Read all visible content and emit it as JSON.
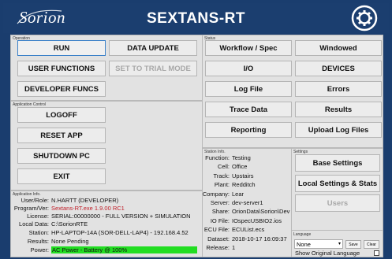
{
  "header": {
    "logo_text": "Sorion",
    "title": "SEXTANS-RT",
    "settings_icon": "gear-refresh-icon"
  },
  "operation": {
    "label": "Operation",
    "buttons": {
      "run": "RUN",
      "data_update": "DATA UPDATE",
      "user_functions": "USER FUNCTIONS",
      "set_to_trial_mode": "SET TO TRIAL MODE",
      "developer_funcs": "DEVELOPER FUNCS"
    }
  },
  "status": {
    "label": "Status",
    "buttons": {
      "workflow_spec": "Workflow / Spec",
      "windowed": "Windowed",
      "io": "I/O",
      "devices": "DEVICES",
      "log_file": "Log File",
      "errors": "Errors",
      "trace_data": "Trace Data",
      "results": "Results",
      "reporting": "Reporting",
      "upload_log_files": "Upload Log Files"
    }
  },
  "application_control": {
    "label": "Application Control",
    "buttons": {
      "logoff": "LOGOFF",
      "reset_app": "RESET APP",
      "shutdown_pc": "SHUTDOWN PC",
      "exit": "EXIT"
    }
  },
  "application_info": {
    "label": "Application Info.",
    "rows": [
      {
        "key": "User/Role:",
        "value": "N.HARTT (DEVELOPER)"
      },
      {
        "key": "Program/Ver:",
        "value": "Sextans-RT.exe 1.9.00 RC1"
      },
      {
        "key": "License:",
        "value": "SERIAL:00000000 - FULL VERSION + SIMULATION"
      },
      {
        "key": "Local Data:",
        "value": "C:\\SorionRTE"
      },
      {
        "key": "Station:",
        "value": "HP-LAPTOP-14A (SOR-DELL-LAP4) - 192.168.4.52"
      },
      {
        "key": "Results:",
        "value": "None Pending"
      },
      {
        "key": "Power:",
        "value": "AC Power - Battery @ 100%"
      }
    ]
  },
  "station_info": {
    "label": "Station Info.",
    "rows": [
      {
        "key": "Function:",
        "value": "Testing"
      },
      {
        "key": "Cell:",
        "value": "Office"
      },
      {
        "key": "Track:",
        "value": "Upstairs"
      },
      {
        "key": "Plant:",
        "value": "Redditch"
      },
      {
        "key": "Company:",
        "value": "Lear"
      },
      {
        "key": "Server:",
        "value": "dev-server1"
      },
      {
        "key": "Share:",
        "value": "OrionData\\Sorion\\Dev"
      },
      {
        "key": "IO File:",
        "value": "IOspecUSBIO2.ios"
      },
      {
        "key": "ECU File:",
        "value": "ECUList.ecs"
      },
      {
        "key": "Dataset:",
        "value": "2018-10-17 16:09:37"
      },
      {
        "key": "Release:",
        "value": "1"
      }
    ]
  },
  "settings": {
    "label": "Settings",
    "buttons": {
      "base_settings": "Base Settings",
      "local_settings_stats": "Local Settings & Stats",
      "users": "Users"
    }
  },
  "language": {
    "label": "Language",
    "selected": "None",
    "save": "Save",
    "clear": "Clear",
    "show_original": "Show Original Language"
  },
  "colors": {
    "background": "#1a3d6e",
    "panel": "#e2e2e2",
    "warning_red": "#c0202a",
    "power_green": "#22dd22",
    "selected_border": "#3d82c9"
  }
}
